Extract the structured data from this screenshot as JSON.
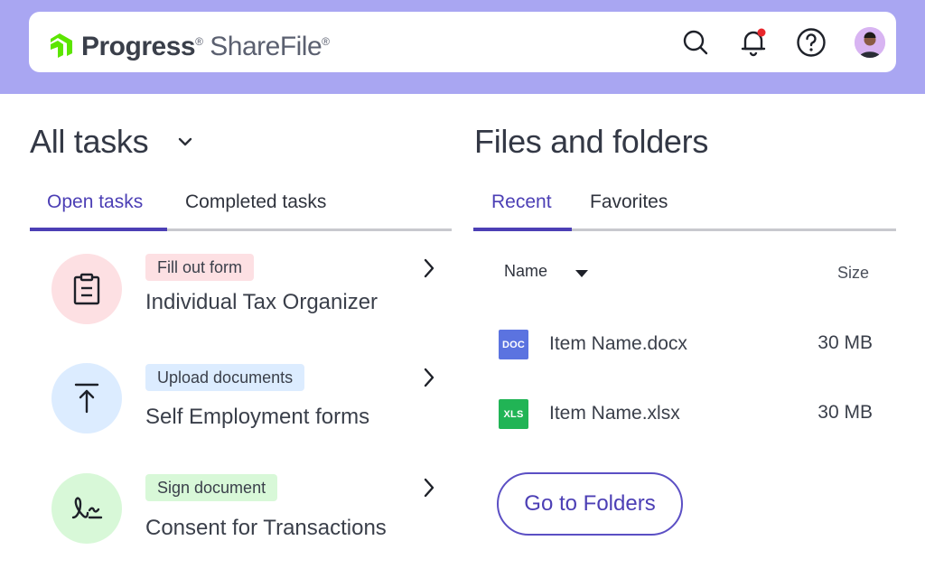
{
  "header": {
    "logo": {
      "brand": "Progress",
      "product": "ShareFile",
      "mark_color": "#5ce500"
    },
    "icons": [
      "search-icon",
      "bell-icon",
      "help-icon"
    ],
    "notification_dot_color": "#e8262b"
  },
  "tasks": {
    "title": "All tasks",
    "tabs": [
      {
        "label": "Open tasks",
        "active": true
      },
      {
        "label": "Completed tasks",
        "active": false
      }
    ],
    "items": [
      {
        "badge": "Fill out form",
        "name": "Individual Tax Organizer",
        "icon": "clipboard-icon",
        "circle_color": "#fde0e3",
        "badge_color": "#fde0e3"
      },
      {
        "badge": "Upload documents",
        "name": "Self Employment forms",
        "icon": "upload-icon",
        "circle_color": "#dcecff",
        "badge_color": "#dcecff"
      },
      {
        "badge": "Sign document",
        "name": "Consent for Transactions",
        "icon": "signature-icon",
        "circle_color": "#d8f8d8",
        "badge_color": "#d8f8d8"
      }
    ]
  },
  "files": {
    "title": "Files and folders",
    "tabs": [
      {
        "label": "Recent",
        "active": true
      },
      {
        "label": "Favorites",
        "active": false
      }
    ],
    "columns": {
      "name": "Name",
      "size": "Size"
    },
    "items": [
      {
        "type_label": "DOC",
        "name": "Item Name.docx",
        "size": "30 MB",
        "color": "#5b73e0"
      },
      {
        "type_label": "XLS",
        "name": "Item Name.xlsx",
        "size": "30 MB",
        "color": "#21b455"
      }
    ],
    "go_button": "Go to Folders"
  },
  "colors": {
    "accent": "#4c3fb5",
    "band": "#a9a6f2"
  }
}
